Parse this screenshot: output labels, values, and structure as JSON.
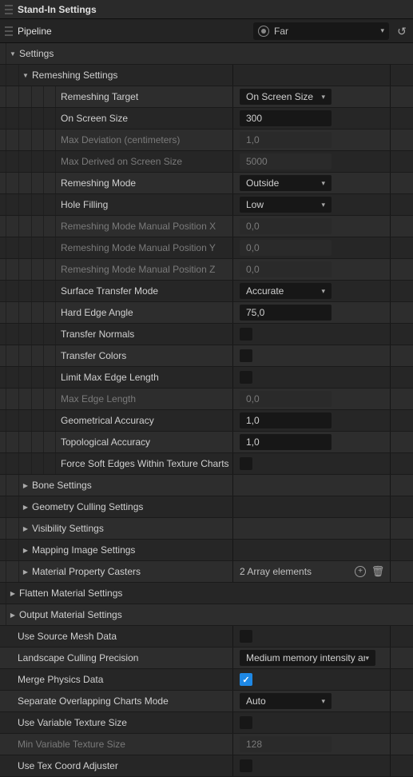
{
  "header": {
    "title": "Stand-In Settings"
  },
  "pipeline": {
    "label": "Pipeline",
    "value": "Far"
  },
  "settings": {
    "label": "Settings"
  },
  "remeshing": {
    "header": "Remeshing Settings",
    "target": {
      "label": "Remeshing Target",
      "value": "On Screen Size"
    },
    "onScreenSize": {
      "label": "On Screen Size",
      "value": "300"
    },
    "maxDeviation": {
      "label": "Max Deviation (centimeters)",
      "value": "1,0"
    },
    "maxDerived": {
      "label": "Max Derived on Screen Size",
      "value": "5000"
    },
    "mode": {
      "label": "Remeshing Mode",
      "value": "Outside"
    },
    "holeFilling": {
      "label": "Hole Filling",
      "value": "Low"
    },
    "manualX": {
      "label": "Remeshing Mode Manual Position X",
      "value": "0,0"
    },
    "manualY": {
      "label": "Remeshing Mode Manual Position Y",
      "value": "0,0"
    },
    "manualZ": {
      "label": "Remeshing Mode Manual Position Z",
      "value": "0,0"
    },
    "surfaceTransfer": {
      "label": "Surface Transfer Mode",
      "value": "Accurate"
    },
    "hardEdge": {
      "label": "Hard Edge Angle",
      "value": "75,0"
    },
    "transferNormals": {
      "label": "Transfer Normals"
    },
    "transferColors": {
      "label": "Transfer Colors"
    },
    "limitMaxEdge": {
      "label": "Limit Max Edge Length"
    },
    "maxEdgeLength": {
      "label": "Max Edge Length",
      "value": "0,0"
    },
    "geoAccuracy": {
      "label": "Geometrical Accuracy",
      "value": "1,0"
    },
    "topoAccuracy": {
      "label": "Topological Accuracy",
      "value": "1,0"
    },
    "forceSoftEdges": {
      "label": "Force Soft Edges Within Texture Charts"
    }
  },
  "sections": {
    "bone": "Bone Settings",
    "geoCulling": "Geometry Culling Settings",
    "visibility": "Visibility Settings",
    "mappingImage": "Mapping Image Settings",
    "materialCasters": {
      "label": "Material Property Casters",
      "value": "2 Array elements"
    },
    "flattenMaterial": "Flatten Material Settings",
    "outputMaterial": "Output Material Settings"
  },
  "bottom": {
    "useSourceMesh": {
      "label": "Use Source Mesh Data"
    },
    "landscapeCulling": {
      "label": "Landscape Culling Precision",
      "value": "Medium memory intensity an"
    },
    "mergePhysics": {
      "label": "Merge Physics Data"
    },
    "separateCharts": {
      "label": "Separate Overlapping Charts Mode",
      "value": "Auto"
    },
    "useVarTexSize": {
      "label": "Use Variable Texture Size"
    },
    "minVarTexSize": {
      "label": "Min Variable Texture Size",
      "value": "128"
    },
    "useTexCoordAdj": {
      "label": "Use Tex Coord Adjuster"
    }
  }
}
